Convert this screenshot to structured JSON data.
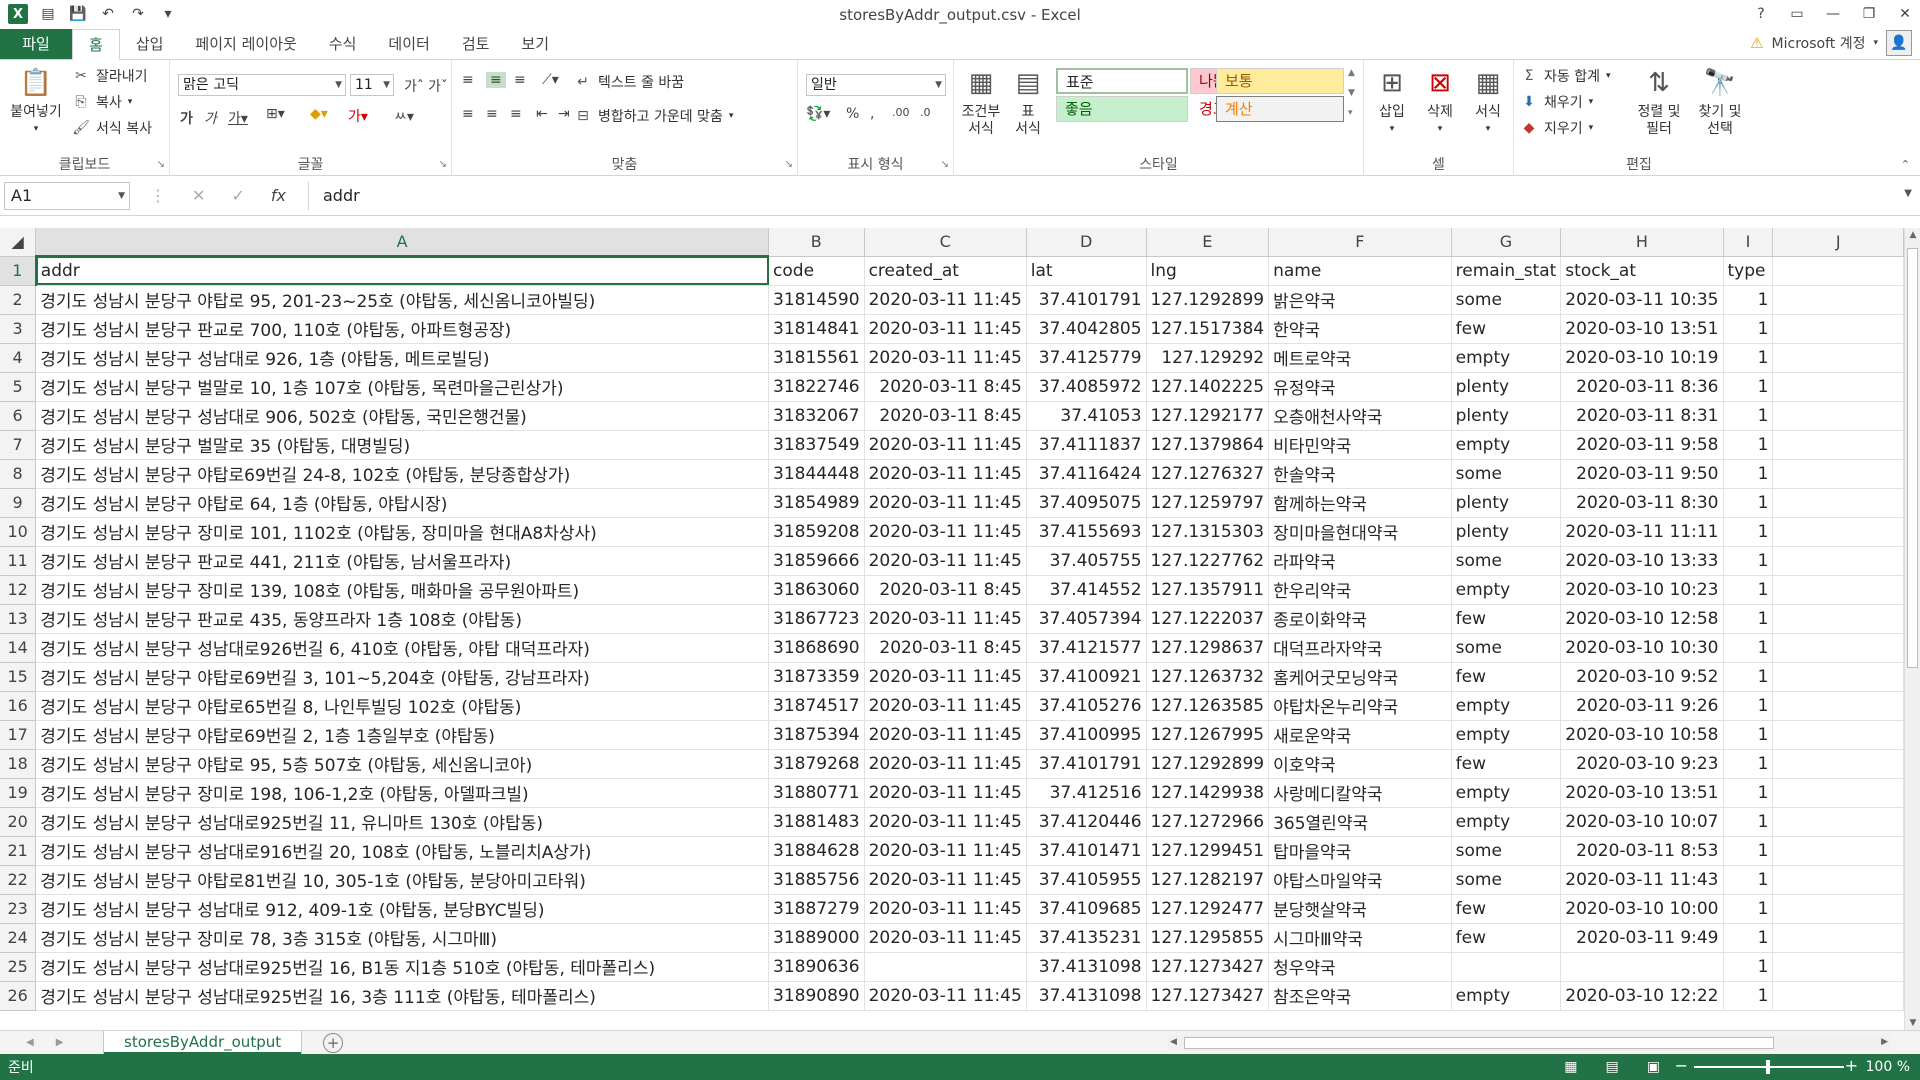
{
  "window": {
    "title": "storesByAddr_output.csv - Excel",
    "help": "?",
    "controls": [
      "▭",
      "—",
      "❐",
      "✕"
    ]
  },
  "ribbon_tabs": [
    "파일",
    "홈",
    "삽입",
    "페이지 레이아웃",
    "수식",
    "데이터",
    "검토",
    "보기"
  ],
  "account": {
    "name": "Microsoft 계정"
  },
  "ribbon": {
    "clipboard": {
      "label": "클립보드",
      "paste": "붙여넣기",
      "cut": "잘라내기",
      "copy": "복사",
      "format_painter": "서식 복사"
    },
    "font": {
      "label": "글꼴",
      "name": "맑은 고딕",
      "size": "11"
    },
    "alignment": {
      "label": "맞춤",
      "wrap": "텍스트 줄 바꿈",
      "merge": "병합하고 가운데 맞춤"
    },
    "number": {
      "label": "표시 형식",
      "format": "일반"
    },
    "styles": {
      "label": "스타일",
      "conditional": "조건부\n서식",
      "table": "표\n서식",
      "normal": "표준",
      "bad": "나쁨",
      "neutral": "보통",
      "good": "좋음",
      "warning": "경고문",
      "calc": "계산"
    },
    "cells": {
      "label": "셀",
      "insert": "삽입",
      "delete": "삭제",
      "format": "서식"
    },
    "editing": {
      "label": "편집",
      "autosum": "자동 합계",
      "fill": "채우기",
      "clear": "지우기",
      "sort": "정렬 및\n필터",
      "find": "찾기 및\n선택"
    }
  },
  "formula_bar": {
    "name_box": "A1",
    "content": "addr"
  },
  "columns": [
    "A",
    "B",
    "C",
    "D",
    "E",
    "F",
    "G",
    "H",
    "I",
    "J"
  ],
  "header_row": [
    "addr",
    "code",
    "created_at",
    "lat",
    "lng",
    "name",
    "remain_stat",
    "stock_at",
    "type"
  ],
  "rows": [
    [
      "경기도 성남시 분당구 야탑로 95, 201-23~25호 (야탑동, 세신옴니코아빌딩)",
      "31814590",
      "2020-03-11 11:45",
      "37.4101791",
      "127.1292899",
      "밝은약국",
      "some",
      "2020-03-11 10:35",
      "1"
    ],
    [
      "경기도 성남시 분당구 판교로 700, 110호 (야탑동, 아파트형공장)",
      "31814841",
      "2020-03-11 11:45",
      "37.4042805",
      "127.1517384",
      "한약국",
      "few",
      "2020-03-10 13:51",
      "1"
    ],
    [
      "경기도 성남시 분당구 성남대로 926, 1층 (야탑동, 메트로빌딩)",
      "31815561",
      "2020-03-11 11:45",
      "37.4125779",
      "127.129292",
      "메트로약국",
      "empty",
      "2020-03-10 10:19",
      "1"
    ],
    [
      "경기도 성남시 분당구 벌말로 10, 1층 107호 (야탑동, 목련마을근린상가)",
      "31822746",
      "2020-03-11 8:45",
      "37.4085972",
      "127.1402225",
      "유정약국",
      "plenty",
      "2020-03-11 8:36",
      "1"
    ],
    [
      "경기도 성남시 분당구 성남대로 906, 502호 (야탑동, 국민은행건물)",
      "31832067",
      "2020-03-11 8:45",
      "37.41053",
      "127.1292177",
      "오층애천사약국",
      "plenty",
      "2020-03-11 8:31",
      "1"
    ],
    [
      "경기도 성남시 분당구 벌말로 35 (야탑동, 대명빌딩)",
      "31837549",
      "2020-03-11 11:45",
      "37.4111837",
      "127.1379864",
      "비타민약국",
      "empty",
      "2020-03-11 9:58",
      "1"
    ],
    [
      "경기도 성남시 분당구 야탑로69번길 24-8, 102호 (야탑동, 분당종합상가)",
      "31844448",
      "2020-03-11 11:45",
      "37.4116424",
      "127.1276327",
      "한솔약국",
      "some",
      "2020-03-11 9:50",
      "1"
    ],
    [
      "경기도 성남시 분당구 야탑로 64, 1층 (야탑동, 야탑시장)",
      "31854989",
      "2020-03-11 11:45",
      "37.4095075",
      "127.1259797",
      "함께하는약국",
      "plenty",
      "2020-03-11 8:30",
      "1"
    ],
    [
      "경기도 성남시 분당구 장미로 101, 1102호 (야탑동, 장미마을 현대A8차상사)",
      "31859208",
      "2020-03-11 11:45",
      "37.4155693",
      "127.1315303",
      "장미마을현대약국",
      "plenty",
      "2020-03-11 11:11",
      "1"
    ],
    [
      "경기도 성남시 분당구 판교로 441, 211호 (야탑동, 남서울프라자)",
      "31859666",
      "2020-03-11 11:45",
      "37.405755",
      "127.1227762",
      "라파약국",
      "some",
      "2020-03-10 13:33",
      "1"
    ],
    [
      "경기도 성남시 분당구 장미로 139, 108호 (야탑동, 매화마을 공무원아파트)",
      "31863060",
      "2020-03-11 8:45",
      "37.414552",
      "127.1357911",
      "한우리약국",
      "empty",
      "2020-03-10 10:23",
      "1"
    ],
    [
      "경기도 성남시 분당구 판교로 435, 동양프라자 1층 108호 (야탑동)",
      "31867723",
      "2020-03-11 11:45",
      "37.4057394",
      "127.1222037",
      "종로이화약국",
      "few",
      "2020-03-10 12:58",
      "1"
    ],
    [
      "경기도 성남시 분당구 성남대로926번길 6, 410호 (야탑동, 야탑 대덕프라자)",
      "31868690",
      "2020-03-11 8:45",
      "37.4121577",
      "127.1298637",
      "대덕프라자약국",
      "some",
      "2020-03-10 10:30",
      "1"
    ],
    [
      "경기도 성남시 분당구 야탑로69번길 3, 101~5,204호 (야탑동, 강남프라자)",
      "31873359",
      "2020-03-11 11:45",
      "37.4100921",
      "127.1263732",
      "홈케어굿모닝약국",
      "few",
      "2020-03-10 9:52",
      "1"
    ],
    [
      "경기도 성남시 분당구 야탑로65번길 8, 나인투빌딩 102호 (야탑동)",
      "31874517",
      "2020-03-11 11:45",
      "37.4105276",
      "127.1263585",
      "야탑차온누리약국",
      "empty",
      "2020-03-11 9:26",
      "1"
    ],
    [
      "경기도 성남시 분당구 야탑로69번길 2, 1층 1층일부호 (야탑동)",
      "31875394",
      "2020-03-11 11:45",
      "37.4100995",
      "127.1267995",
      "새로운약국",
      "empty",
      "2020-03-10 10:58",
      "1"
    ],
    [
      "경기도 성남시 분당구 야탑로 95, 5층 507호 (야탑동, 세신옴니코아)",
      "31879268",
      "2020-03-11 11:45",
      "37.4101791",
      "127.1292899",
      "이호약국",
      "few",
      "2020-03-10 9:23",
      "1"
    ],
    [
      "경기도 성남시 분당구 장미로 198, 106-1,2호 (야탑동, 아델파크빌)",
      "31880771",
      "2020-03-11 11:45",
      "37.412516",
      "127.1429938",
      "사랑메디칼약국",
      "empty",
      "2020-03-10 13:51",
      "1"
    ],
    [
      "경기도 성남시 분당구 성남대로925번길 11, 유니마트 130호 (야탑동)",
      "31881483",
      "2020-03-11 11:45",
      "37.4120446",
      "127.1272966",
      "365열린약국",
      "empty",
      "2020-03-10 10:07",
      "1"
    ],
    [
      "경기도 성남시 분당구 성남대로916번길 20, 108호 (야탑동, 노블리치A상가)",
      "31884628",
      "2020-03-11 11:45",
      "37.4101471",
      "127.1299451",
      "탑마을약국",
      "some",
      "2020-03-11 8:53",
      "1"
    ],
    [
      "경기도 성남시 분당구 야탑로81번길 10, 305-1호 (야탑동, 분당아미고타워)",
      "31885756",
      "2020-03-11 11:45",
      "37.4105955",
      "127.1282197",
      "야탑스마일약국",
      "some",
      "2020-03-11 11:43",
      "1"
    ],
    [
      "경기도 성남시 분당구 성남대로 912, 409-1호 (야탑동, 분당BYC빌딩)",
      "31887279",
      "2020-03-11 11:45",
      "37.4109685",
      "127.1292477",
      "분당햇살약국",
      "few",
      "2020-03-10 10:00",
      "1"
    ],
    [
      "경기도 성남시 분당구 장미로 78, 3층 315호 (야탑동, 시그마Ⅲ)",
      "31889000",
      "2020-03-11 11:45",
      "37.4135231",
      "127.1295855",
      "시그마Ⅲ약국",
      "few",
      "2020-03-11 9:49",
      "1"
    ],
    [
      "경기도 성남시 분당구 성남대로925번길 16, B1동 지1층 510호 (야탑동, 테마폴리스)",
      "31890636",
      "",
      "37.4131098",
      "127.1273427",
      "청우약국",
      "",
      "",
      "1"
    ],
    [
      "경기도 성남시 분당구 성남대로925번길 16, 3층 111호 (야탑동, 테마폴리스)",
      "31890890",
      "2020-03-11 11:45",
      "37.4131098",
      "127.1273427",
      "참조은약국",
      "empty",
      "2020-03-10 12:22",
      "1"
    ]
  ],
  "sheet_tab": "storesByAddr_output",
  "status": {
    "ready": "준비",
    "zoom": "100 %"
  },
  "colors": {
    "accent": "#217346"
  }
}
